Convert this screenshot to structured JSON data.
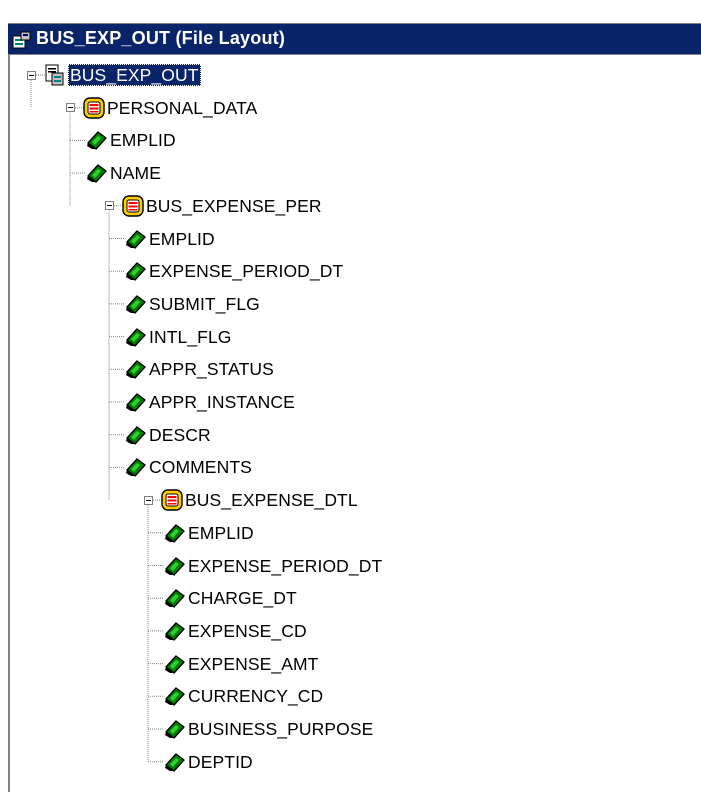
{
  "window": {
    "title": "BUS_EXP_OUT (File Layout)"
  },
  "tree": {
    "root": {
      "label": "BUS_EXP_OUT",
      "icon": "file-layout-icon"
    },
    "personal_data": {
      "label": "PERSONAL_DATA",
      "icon": "record-icon",
      "fields": [
        "EMPLID",
        "NAME"
      ]
    },
    "bus_expense_per": {
      "label": "BUS_EXPENSE_PER",
      "icon": "record-icon",
      "fields": [
        "EMPLID",
        "EXPENSE_PERIOD_DT",
        "SUBMIT_FLG",
        "INTL_FLG",
        "APPR_STATUS",
        "APPR_INSTANCE",
        "DESCR",
        "COMMENTS"
      ]
    },
    "bus_expense_dtl": {
      "label": "BUS_EXPENSE_DTL",
      "icon": "record-icon",
      "fields": [
        "EMPLID",
        "EXPENSE_PERIOD_DT",
        "CHARGE_DT",
        "EXPENSE_CD",
        "EXPENSE_AMT",
        "CURRENCY_CD",
        "BUSINESS_PURPOSE",
        "DEPTID"
      ]
    },
    "field_icon": "field-icon"
  },
  "colors": {
    "titlebar": "#0a246a",
    "selection": "#0a246a",
    "record_icon": "#ffcc00",
    "field_icon": "#008000"
  }
}
